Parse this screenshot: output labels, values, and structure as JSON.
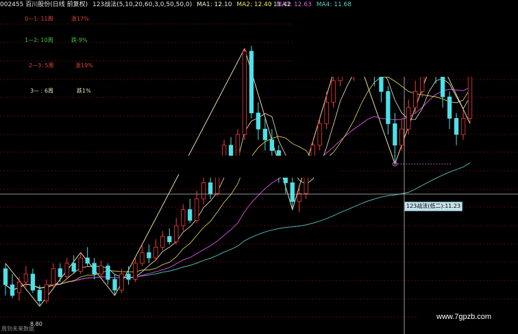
{
  "header": {
    "stock": "002455 百川股份(日线 前复权)",
    "indicator": "123战法(5,10,20,60,3,0,50,50,0)",
    "ma1": "MA1: 12.10",
    "ma2": "MA2: 12.40",
    "ma3": "MA3: 12.63",
    "ma4": "MA4: 11.68",
    "value": ": 11.42"
  },
  "legend": [
    {
      "stage": "0—1: 11周",
      "change": "涨17%",
      "color": "#e0473a"
    },
    {
      "stage": "1—2: 10周",
      "change": "跌-9%",
      "color": "#48c848"
    },
    {
      "stage": "2—3: 5周",
      "change": "涨19%",
      "color": "#e0473a"
    },
    {
      "stage": "3— : 6周",
      "change": "跌1%",
      "color": "#e7e2b4"
    }
  ],
  "tooltip": "123战法(低二):11.23",
  "low_label": "8.80",
  "bottom_note": "周到未来数据",
  "watermark": "www.7gpzb.com",
  "colors": {
    "background": "#000000",
    "grid": "#7a1010",
    "up": "#ff3b3b",
    "down": "#4fe0e8",
    "ma_fast": "#f0f0cf",
    "ma_mid": "#f2e36a",
    "ma3": "#c84fd0",
    "ma4": "#4fb8b8",
    "zigzag": "#e8e2a8",
    "crosshair": "#c8c8c8"
  },
  "chart_data": {
    "type": "candlestick",
    "title": "002455 百川股份(日线 前复权)",
    "indicator": "123战法",
    "period": "weekly",
    "ylim": [
      8.5,
      14.3
    ],
    "series": [
      {
        "name": "MA1",
        "last": 12.1
      },
      {
        "name": "MA2",
        "last": 12.4
      },
      {
        "name": "MA3",
        "last": 12.63
      },
      {
        "name": "MA4",
        "last": 11.68
      }
    ],
    "candles": [
      [
        9.5,
        9.2,
        9.6,
        9.0
      ],
      [
        9.2,
        9.0,
        9.4,
        8.95
      ],
      [
        9.05,
        9.25,
        9.35,
        8.9
      ],
      [
        9.25,
        9.4,
        9.55,
        9.15
      ],
      [
        9.4,
        9.1,
        9.5,
        9.05
      ],
      [
        9.1,
        8.9,
        9.2,
        8.8
      ],
      [
        8.9,
        9.2,
        9.3,
        8.85
      ],
      [
        9.2,
        9.5,
        9.6,
        9.15
      ],
      [
        9.5,
        9.35,
        9.6,
        9.25
      ],
      [
        9.35,
        9.6,
        9.7,
        9.3
      ],
      [
        9.6,
        9.45,
        9.75,
        9.4
      ],
      [
        9.45,
        9.7,
        9.8,
        9.4
      ],
      [
        9.7,
        9.6,
        9.9,
        9.55
      ],
      [
        9.6,
        9.4,
        9.7,
        9.3
      ],
      [
        9.4,
        9.55,
        9.65,
        9.35
      ],
      [
        9.55,
        9.3,
        9.6,
        9.2
      ],
      [
        9.3,
        9.1,
        9.4,
        9.0
      ],
      [
        9.1,
        9.4,
        9.5,
        9.05
      ],
      [
        9.4,
        9.3,
        9.55,
        9.2
      ],
      [
        9.3,
        9.6,
        9.7,
        9.25
      ],
      [
        9.6,
        9.8,
        9.95,
        9.55
      ],
      [
        9.8,
        9.7,
        9.95,
        9.6
      ],
      [
        9.7,
        9.9,
        10.05,
        9.65
      ],
      [
        9.9,
        10.1,
        10.2,
        9.85
      ],
      [
        10.1,
        10.0,
        10.25,
        9.95
      ],
      [
        10.0,
        10.3,
        10.45,
        9.95
      ],
      [
        10.3,
        10.6,
        10.7,
        10.2
      ],
      [
        10.6,
        10.4,
        10.8,
        10.35
      ],
      [
        10.4,
        10.8,
        10.95,
        10.35
      ],
      [
        10.8,
        11.1,
        11.2,
        10.7
      ],
      [
        11.1,
        10.9,
        11.3,
        10.8
      ],
      [
        10.9,
        11.4,
        11.5,
        10.85
      ],
      [
        11.4,
        11.8,
        11.9,
        11.3
      ],
      [
        11.8,
        11.5,
        11.95,
        11.4
      ],
      [
        11.5,
        12.0,
        12.1,
        11.45
      ],
      [
        12.0,
        13.55,
        13.6,
        11.9
      ],
      [
        13.55,
        12.4,
        13.65,
        12.3
      ],
      [
        12.4,
        12.1,
        12.6,
        11.9
      ],
      [
        12.1,
        11.9,
        12.3,
        11.7
      ],
      [
        11.9,
        11.7,
        12.1,
        11.6
      ],
      [
        11.7,
        11.3,
        11.8,
        11.1
      ],
      [
        11.3,
        11.1,
        11.4,
        10.9
      ],
      [
        11.1,
        10.75,
        11.2,
        10.6
      ],
      [
        10.75,
        10.9,
        11.0,
        10.55
      ],
      [
        10.9,
        11.3,
        11.4,
        10.8
      ],
      [
        11.3,
        11.8,
        11.9,
        11.2
      ],
      [
        11.8,
        12.2,
        12.3,
        11.7
      ],
      [
        12.2,
        12.6,
        12.8,
        12.1
      ],
      [
        12.6,
        13.0,
        13.2,
        12.5
      ],
      [
        13.0,
        13.5,
        13.8,
        12.9
      ],
      [
        13.5,
        13.2,
        14.0,
        13.1
      ],
      [
        13.2,
        13.4,
        13.6,
        13.0
      ],
      [
        13.4,
        13.6,
        13.75,
        13.2
      ],
      [
        13.6,
        13.3,
        13.7,
        13.1
      ],
      [
        13.3,
        13.1,
        13.5,
        12.9
      ],
      [
        13.1,
        12.8,
        13.2,
        12.6
      ],
      [
        12.8,
        12.2,
        12.9,
        12.0
      ],
      [
        12.2,
        11.8,
        12.4,
        11.45
      ],
      [
        11.8,
        12.1,
        12.3,
        11.7
      ],
      [
        12.1,
        12.5,
        12.65,
        12.0
      ],
      [
        12.5,
        12.8,
        13.0,
        12.4
      ],
      [
        12.8,
        13.2,
        13.4,
        12.7
      ],
      [
        13.2,
        13.4,
        13.7,
        13.1
      ],
      [
        13.4,
        13.1,
        13.55,
        12.95
      ],
      [
        13.1,
        12.7,
        13.2,
        12.5
      ],
      [
        12.7,
        12.3,
        12.8,
        12.1
      ],
      [
        12.3,
        12.0,
        12.4,
        11.8
      ],
      [
        12.0,
        12.3,
        12.45,
        11.9
      ],
      [
        12.3,
        14.2,
        14.3,
        12.2
      ]
    ]
  }
}
